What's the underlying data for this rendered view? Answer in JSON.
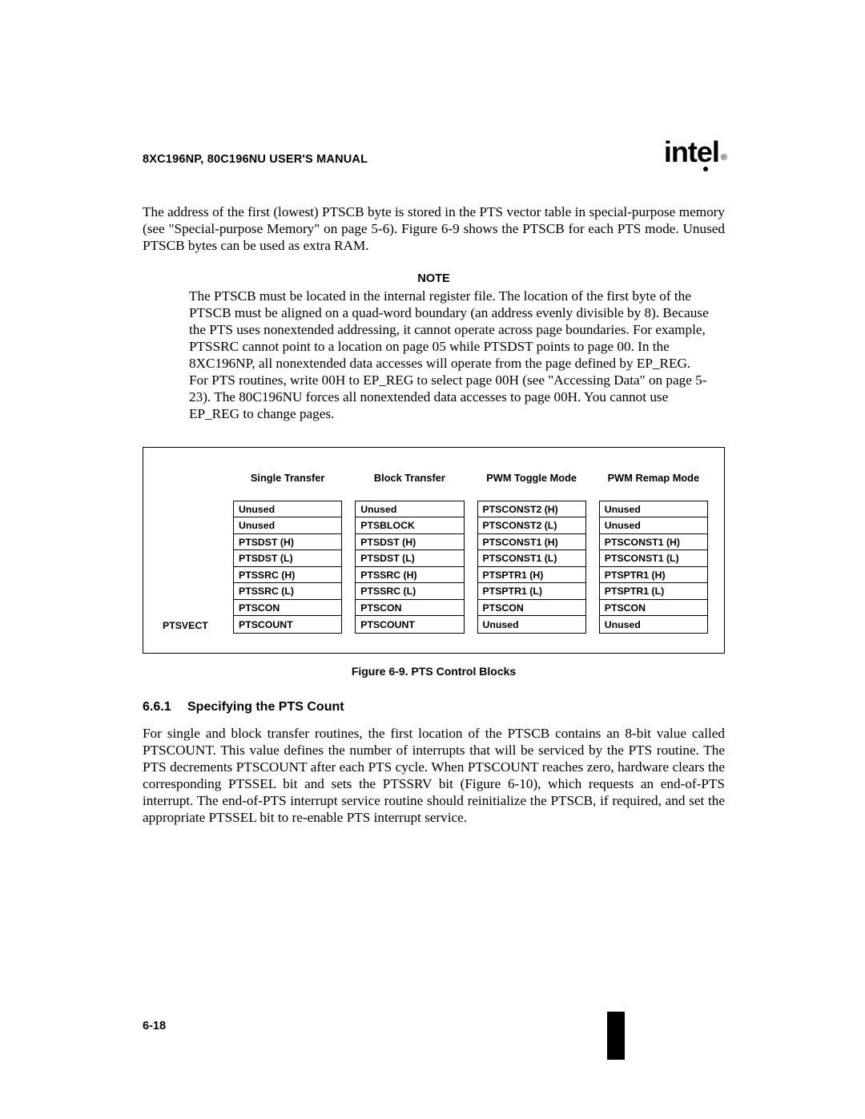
{
  "header": {
    "manual_title": "8XC196NP, 80C196NU USER'S MANUAL",
    "logo_text": "int",
    "logo_e": "e",
    "logo_l": "l",
    "logo_reg": "®"
  },
  "para1": "The address of the first (lowest) PTSCB byte is stored in the PTS vector table in special-purpose memory (see \"Special-purpose Memory\" on page 5-6). Figure 6-9 shows the PTSCB for each PTS mode. Unused PTSCB bytes can be used as extra RAM.",
  "note": {
    "title": "NOTE",
    "body": "The PTSCB must be located in the internal register file. The location of the first byte of the PTSCB must be aligned on a quad-word boundary (an address evenly divisible by 8). Because the PTS uses nonextended addressing, it cannot operate across page boundaries. For example, PTSSRC cannot point to a location on page 05 while PTSDST points to page 00. In the 8XC196NP, all nonextended data accesses will operate from the page defined by EP_REG. For PTS routines, write 00H to EP_REG to select page 00H (see \"Accessing Data\" on page 5-23). The 80C196NU forces all nonextended data accesses to page 00H. You cannot use EP_REG to change pages."
  },
  "figure": {
    "row_label": "PTSVECT",
    "columns": [
      {
        "header": "Single Transfer",
        "cells": [
          "Unused",
          "Unused",
          "PTSDST (H)",
          "PTSDST (L)",
          "PTSSRC (H)",
          "PTSSRC (L)",
          "PTSCON",
          "PTSCOUNT"
        ]
      },
      {
        "header": "Block Transfer",
        "cells": [
          "Unused",
          "PTSBLOCK",
          "PTSDST (H)",
          "PTSDST (L)",
          "PTSSRC (H)",
          "PTSSRC (L)",
          "PTSCON",
          "PTSCOUNT"
        ]
      },
      {
        "header": "PWM Toggle Mode",
        "cells": [
          "PTSCONST2 (H)",
          "PTSCONST2 (L)",
          "PTSCONST1 (H)",
          "PTSCONST1 (L)",
          "PTSPTR1 (H)",
          "PTSPTR1 (L)",
          "PTSCON",
          "Unused"
        ]
      },
      {
        "header": "PWM Remap Mode",
        "cells": [
          "Unused",
          "Unused",
          "PTSCONST1 (H)",
          "PTSCONST1 (L)",
          "PTSPTR1 (H)",
          "PTSPTR1 (L)",
          "PTSCON",
          "Unused"
        ]
      }
    ],
    "caption": "Figure 6-9.  PTS Control Blocks"
  },
  "subsection": {
    "number": "6.6.1",
    "title": "Specifying the PTS Count"
  },
  "para2": "For single and block transfer routines, the first location of the PTSCB contains an 8-bit value called PTSCOUNT. This value defines the number of interrupts that will be serviced by the PTS routine. The PTS decrements PTSCOUNT after each PTS cycle. When PTSCOUNT reaches zero, hardware clears the corresponding PTSSEL bit and sets the PTSSRV bit (Figure 6-10), which requests an end-of-PTS interrupt. The end-of-PTS interrupt service routine should reinitialize the PTSCB, if required, and set the appropriate PTSSEL bit to re-enable PTS interrupt service.",
  "page_number": "6-18"
}
